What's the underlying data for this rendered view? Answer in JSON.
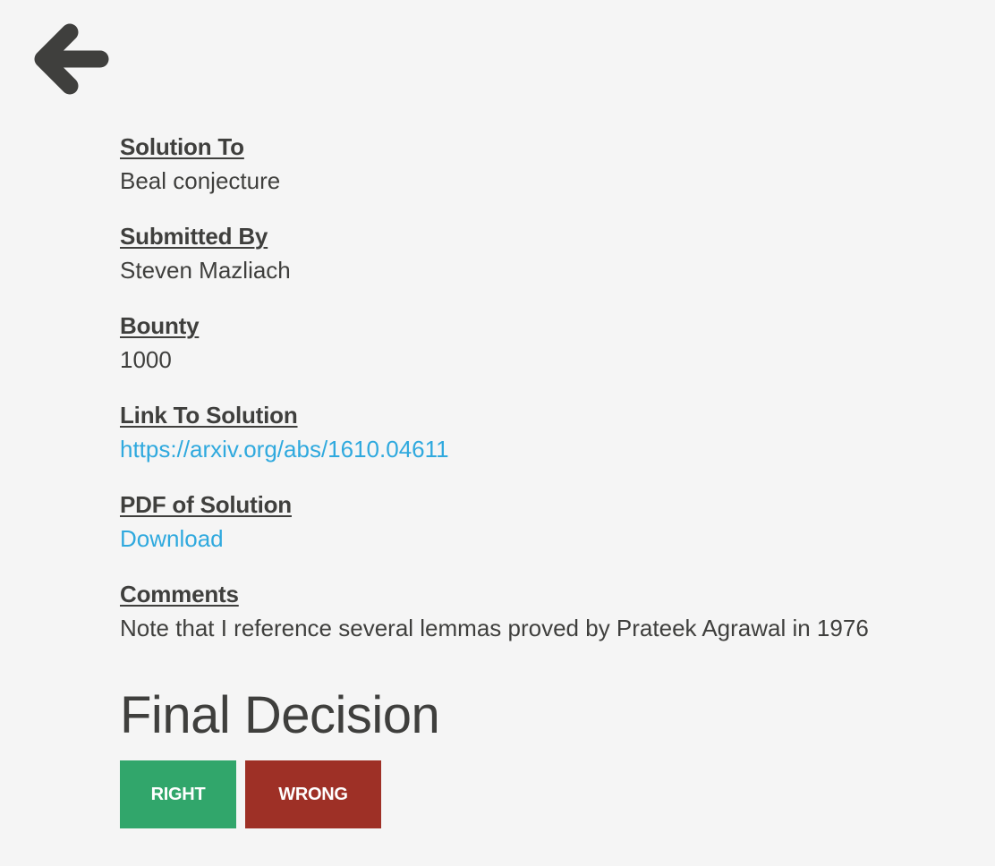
{
  "navigation": {
    "back_icon": "arrow-left-icon"
  },
  "fields": {
    "solution_to": {
      "label": "Solution To",
      "value": "Beal conjecture"
    },
    "submitted_by": {
      "label": "Submitted By",
      "value": "Steven Mazliach"
    },
    "bounty": {
      "label": "Bounty",
      "value": "1000"
    },
    "link_to_solution": {
      "label": "Link To Solution",
      "value": "https://arxiv.org/abs/1610.04611"
    },
    "pdf_of_solution": {
      "label": "PDF of Solution",
      "value": "Download"
    },
    "comments": {
      "label": "Comments",
      "value": "Note that I reference several lemmas proved by Prateek Agrawal in 1976"
    }
  },
  "decision": {
    "title": "Final Decision",
    "right_label": "RIGHT",
    "wrong_label": "WRONG"
  },
  "colors": {
    "background": "#f5f5f5",
    "text": "#3f3f3d",
    "link": "#2fa9de",
    "right_button": "#31a66b",
    "wrong_button": "#9e3026"
  }
}
